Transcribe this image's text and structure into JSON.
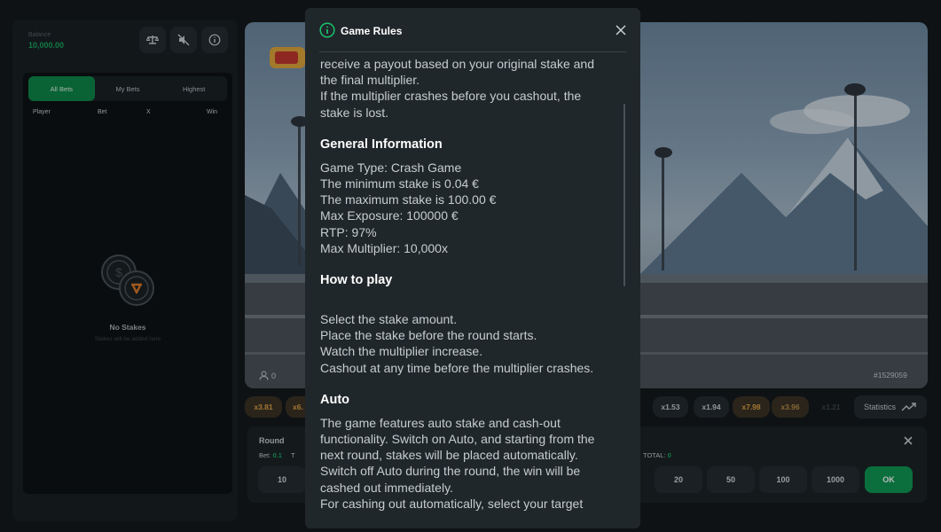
{
  "header": {
    "balance_label": "Balance",
    "balance_value": "10,000.00",
    "icons": [
      "balance-scale-icon",
      "mute-icon",
      "info-icon"
    ]
  },
  "bets": {
    "tabs": [
      {
        "label": "All Bets",
        "active": true
      },
      {
        "label": "My Bets",
        "active": false
      },
      {
        "label": "Highest",
        "active": false
      }
    ],
    "columns": [
      "Player",
      "Bet",
      "X",
      "Win"
    ],
    "empty_title": "No Stakes",
    "empty_subtitle": "Stakes will be added here"
  },
  "game": {
    "players_count": "0",
    "round_id": "#1529059",
    "multipliers": [
      {
        "label": "x3.81",
        "color": "#e2a54a"
      },
      {
        "label": "x6.",
        "color": "#e2a54a"
      },
      {
        "label": "x1.53",
        "color": "#c9d1d4"
      },
      {
        "label": "x1.94",
        "color": "#c9d1d4"
      },
      {
        "label": "x7.98",
        "color": "#e2a54a"
      },
      {
        "label": "x3.96",
        "color": "#e2a54a"
      },
      {
        "label": "x1.21",
        "color": "#c9d1d4"
      }
    ],
    "statistics_label": "Statistics"
  },
  "bet_panel": {
    "round_label": "Round",
    "bet_label": "Bet:",
    "bet_value": "0.1",
    "bet_suffix": "T",
    "total_label": "TOTAL:",
    "total_value": "0",
    "chips": [
      "10",
      "20",
      "50",
      "100",
      "1000"
    ],
    "ok_label": "OK"
  },
  "modal": {
    "title": "Game Rules",
    "intro_lines": [
      "receive a payout based on your original stake and",
      "the final multiplier.",
      "If the multiplier crashes before you cashout, the",
      "stake is lost."
    ],
    "general_heading": "General Information",
    "general_lines": [
      "Game Type: Crash Game",
      "The minimum stake is 0.04 €",
      "The maximum stake is 100.00 €",
      "Max Exposure: 100000 €",
      "RTP: 97%",
      "Max Multiplier: 10,000x"
    ],
    "howto_heading": "How to play",
    "howto_lines": [
      "Select the stake amount.",
      "Place the stake before the round starts.",
      "Watch the multiplier increase.",
      "Cashout at any time before the multiplier crashes."
    ],
    "auto_heading": "Auto",
    "auto_lines": [
      "The game features auto stake and cash-out",
      "functionality. Switch on Auto, and starting from the",
      "next round, stakes will be placed automatically.",
      "Switch off Auto during the round, the win will be",
      "cashed out immediately.",
      "For cashing out automatically, select your target"
    ]
  }
}
